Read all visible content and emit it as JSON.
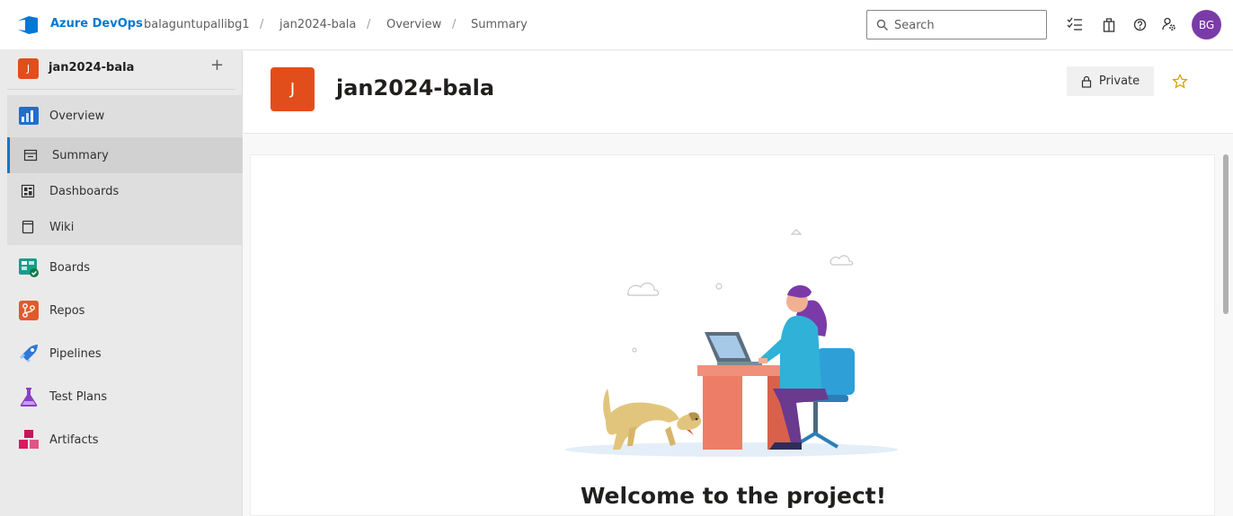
{
  "topbar": {
    "brand": "Azure DevOps",
    "breadcrumb": [
      "balaguntupallibg1",
      "jan2024-bala",
      "Overview",
      "Summary"
    ],
    "search_placeholder": "Search",
    "avatar_initials": "BG"
  },
  "sidebar": {
    "project_initial": "J",
    "project_name": "jan2024-bala",
    "add_symbol": "+",
    "items": [
      {
        "label": "Overview",
        "icon": "overview-icon"
      },
      {
        "label": "Summary",
        "icon": "summary-icon"
      },
      {
        "label": "Dashboards",
        "icon": "dashboards-icon"
      },
      {
        "label": "Wiki",
        "icon": "wiki-icon"
      },
      {
        "label": "Boards",
        "icon": "boards-icon"
      },
      {
        "label": "Repos",
        "icon": "repos-icon"
      },
      {
        "label": "Pipelines",
        "icon": "pipelines-icon"
      },
      {
        "label": "Test Plans",
        "icon": "test-plans-icon"
      },
      {
        "label": "Artifacts",
        "icon": "artifacts-icon"
      }
    ]
  },
  "main": {
    "project_initial": "J",
    "title": "jan2024-bala",
    "private_label": "Private",
    "welcome": "Welcome to the project!"
  },
  "colors": {
    "accent": "#0078d4",
    "project_badge": "#e24e1b",
    "avatar": "#7a3ba8"
  }
}
